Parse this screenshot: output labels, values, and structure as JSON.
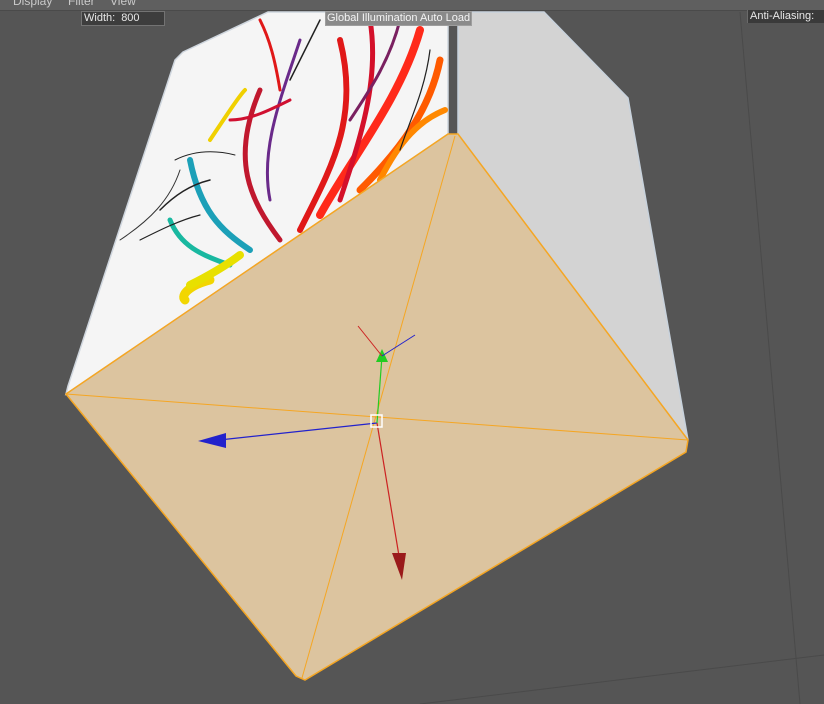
{
  "menu": {
    "items": [
      {
        "label": "Display"
      },
      {
        "label": "Filter"
      },
      {
        "label": "View"
      }
    ]
  },
  "hud": {
    "width_label": "Width:",
    "width_value": "800",
    "gi_label": "Global Illumination Auto Load",
    "aa_label": "Anti-Aliasing:"
  },
  "scene": {
    "object": "cube",
    "selected_face_color": "#dcc49f",
    "selection_outline_color": "#f5a623",
    "side_face_color": "#d3d3d3",
    "textured_face_color": "#f5f5f5",
    "gizmo": {
      "x_axis_color": "#cc2222",
      "y_axis_color": "#22cc22",
      "z_axis_color": "#2222cc"
    }
  }
}
